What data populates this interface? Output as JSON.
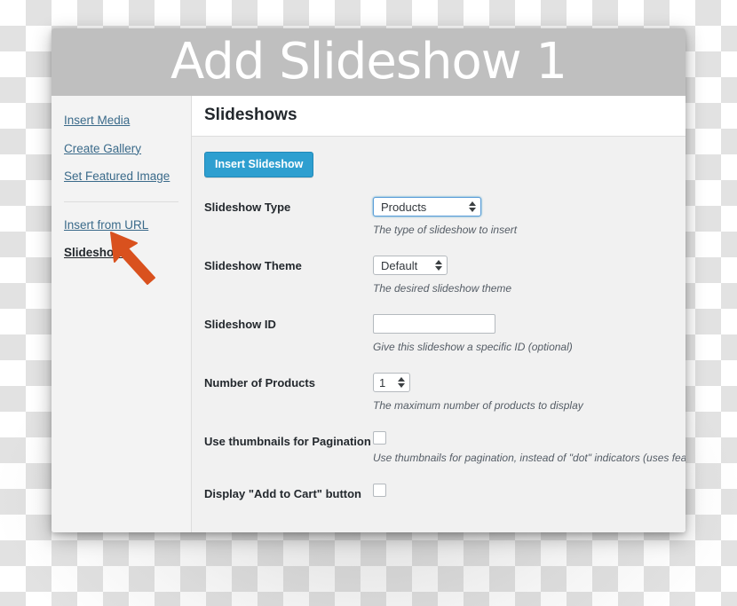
{
  "window": {
    "title": "Add Slideshow 1",
    "header_bg": "#bfbfbf",
    "title_color": "#ffffff"
  },
  "sidebar": {
    "items": [
      {
        "label": "Insert Media",
        "active": false
      },
      {
        "label": "Create Gallery",
        "active": false
      },
      {
        "label": "Set Featured Image",
        "active": false
      },
      {
        "label": "Insert from URL",
        "active": false
      },
      {
        "label": "Slideshows",
        "active": true
      }
    ],
    "link_color": "#3a6a8a",
    "active_color": "#23282d"
  },
  "content": {
    "heading": "Slideshows",
    "primary_button": {
      "label": "Insert Slideshow",
      "color": "#2e9fd0"
    },
    "fields": [
      {
        "label": "Slideshow Type",
        "control": "select",
        "value": "Products",
        "focused": true,
        "help": "The type of slideshow to insert"
      },
      {
        "label": "Slideshow Theme",
        "control": "select",
        "value": "Default",
        "focused": false,
        "help": "The desired slideshow theme"
      },
      {
        "label": "Slideshow ID",
        "control": "text",
        "value": "",
        "placeholder": "",
        "help": "Give this slideshow a specific ID (optional)"
      },
      {
        "label": "Number of Products",
        "control": "number",
        "value": "1",
        "help": "The maximum number of products to display"
      },
      {
        "label": "Use thumbnails for Pagination",
        "control": "checkbox",
        "checked": false,
        "help": "Use thumbnails for pagination, instead of \"dot\" indicators (uses featur"
      },
      {
        "label": "Display \"Add to Cart\" button",
        "control": "checkbox",
        "checked": false,
        "help": ""
      }
    ]
  },
  "annotation": {
    "arrow_color": "#d9511e",
    "points_at": "Slideshows"
  }
}
